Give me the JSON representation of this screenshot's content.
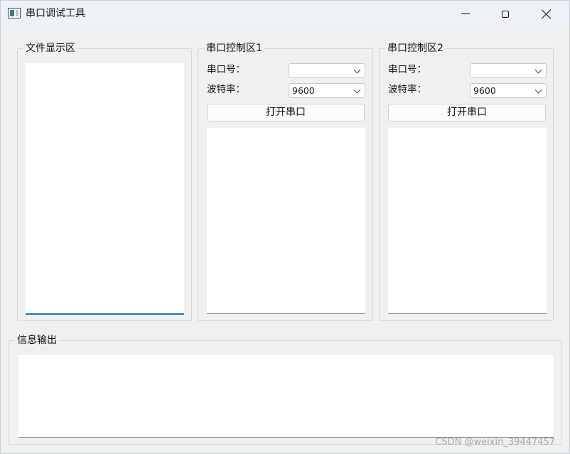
{
  "window": {
    "title": "串口调试工具"
  },
  "file_group": {
    "title": "文件显示区"
  },
  "port_groups": [
    {
      "title": "串口控制区1",
      "port_label": "串口号：",
      "port_value": "",
      "baud_label": "波特率：",
      "baud_value": "9600",
      "open_button": "打开串口"
    },
    {
      "title": "串口控制区2",
      "port_label": "串口号：",
      "port_value": "",
      "baud_label": "波特率：",
      "baud_value": "9600",
      "open_button": "打开串口"
    }
  ],
  "output_group": {
    "title": "信息输出"
  },
  "watermark": "CSDN @weixin_39447457",
  "icons": [
    "app-icon",
    "minimize-icon",
    "maximize-icon",
    "close-icon",
    "chevron-down-icon"
  ]
}
